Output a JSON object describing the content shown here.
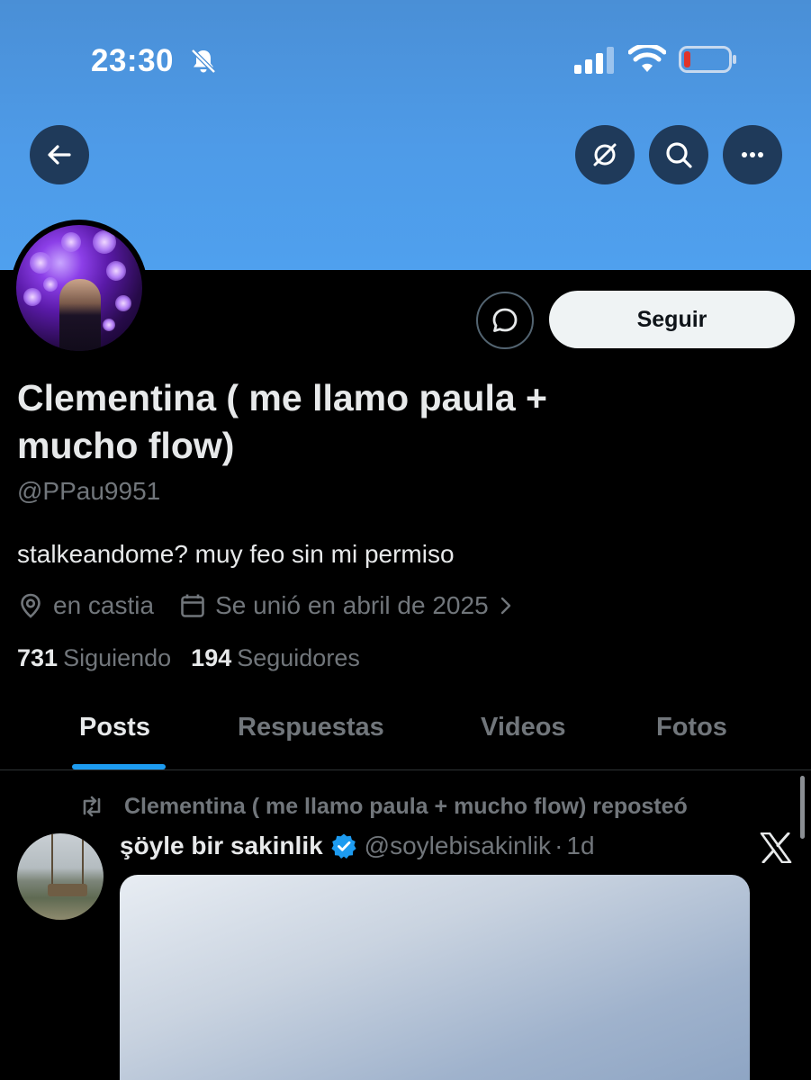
{
  "status_bar": {
    "time": "23:30",
    "icons": [
      "bell-off-icon",
      "cellular-signal-icon",
      "wifi-icon",
      "battery-low-icon"
    ],
    "battery_color": "#e0342a"
  },
  "nav": {
    "back_icon": "arrow-left-icon",
    "actions": [
      "grok-icon",
      "search-icon",
      "more-icon"
    ]
  },
  "profile": {
    "display_name": "Clementina ( me llamo paula + mucho flow)",
    "handle": "@PPau9951",
    "bio": "stalkeandome? muy feo sin mi permiso",
    "location": "en castia",
    "joined": "Se unió en abril de 2025",
    "following_count": "731",
    "following_label": "Siguiendo",
    "followers_count": "194",
    "followers_label": "Seguidores",
    "follow_button": "Seguir"
  },
  "tabs": [
    {
      "label": "Posts",
      "active": true
    },
    {
      "label": "Respuestas",
      "active": false
    },
    {
      "label": "Videos",
      "active": false
    },
    {
      "label": "Fotos",
      "active": false
    }
  ],
  "post": {
    "repost_text": "Clementina ( me llamo paula + mucho flow) reposteó",
    "author_name": "şöyle bir sakinlik",
    "author_handle": "@soylebisakinlik",
    "separator": "·",
    "time": "1d",
    "verified": true
  },
  "colors": {
    "accent": "#1d9bf0",
    "banner": "#4e9be8",
    "muted_text": "#71767b"
  }
}
